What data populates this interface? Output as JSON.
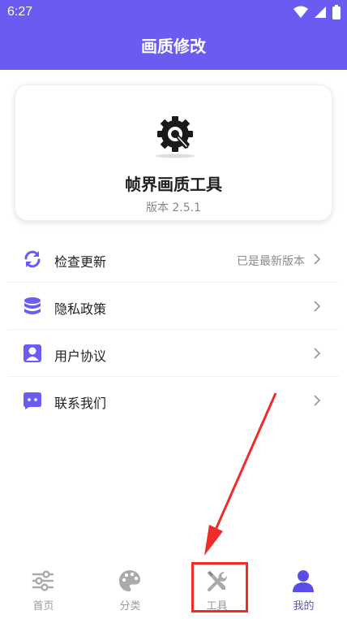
{
  "status_bar": {
    "time": "6:27"
  },
  "app_bar": {
    "title": "画质修改"
  },
  "app_card": {
    "name": "帧界画质工具",
    "version": "版本 2.5.1"
  },
  "menu": [
    {
      "icon": "refresh-icon",
      "label": "检查更新",
      "value": "已是最新版本"
    },
    {
      "icon": "database-icon",
      "label": "隐私政策",
      "value": ""
    },
    {
      "icon": "user-card-icon",
      "label": "用户协议",
      "value": ""
    },
    {
      "icon": "chat-icon",
      "label": "联系我们",
      "value": ""
    }
  ],
  "tabs": [
    {
      "label": "首页",
      "icon": "sliders-icon",
      "active": false
    },
    {
      "label": "分类",
      "icon": "palette-icon",
      "active": false
    },
    {
      "label": "工具",
      "icon": "tools-icon",
      "active": false
    },
    {
      "label": "我的",
      "icon": "person-icon",
      "active": true
    }
  ],
  "colors": {
    "accent": "#6a5cf0",
    "active_tab": "#5b4ee6",
    "annotation": "#ef2b2b"
  }
}
